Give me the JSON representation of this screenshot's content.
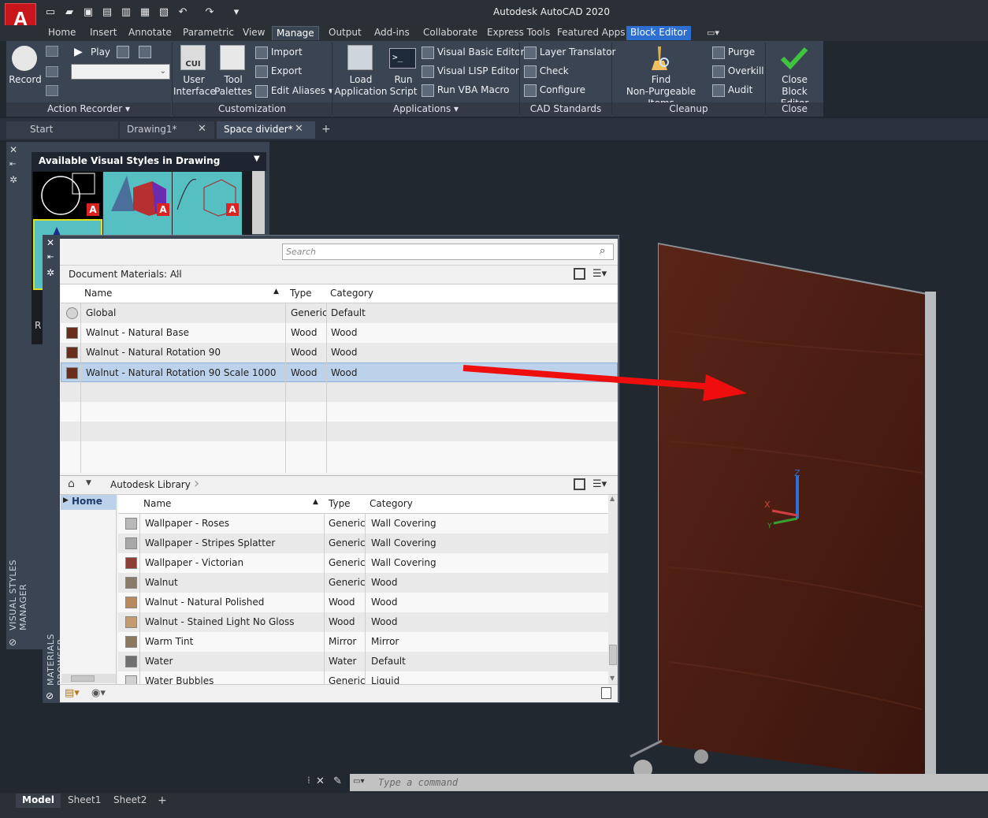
{
  "app": {
    "title": "Autodesk AutoCAD 2020",
    "logo": "A"
  },
  "quick_access": [
    "new-icon",
    "open-icon",
    "save-icon",
    "save-as-icon",
    "open-web-icon",
    "save-web-icon",
    "plot-icon",
    "undo-icon",
    "redo-icon",
    "customize-icon"
  ],
  "menu_tabs": [
    {
      "label": "Home"
    },
    {
      "label": "Insert"
    },
    {
      "label": "Annotate"
    },
    {
      "label": "Parametric"
    },
    {
      "label": "View"
    },
    {
      "label": "Manage",
      "active": true
    },
    {
      "label": "Output"
    },
    {
      "label": "Add-ins"
    },
    {
      "label": "Collaborate"
    },
    {
      "label": "Express Tools"
    },
    {
      "label": "Featured Apps"
    },
    {
      "label": "Block Editor",
      "highlight": true
    }
  ],
  "ribbon": {
    "action_recorder": {
      "record": "Record",
      "play": "Play",
      "title": "Action Recorder"
    },
    "customization": {
      "user_interface": [
        "User",
        "Interface"
      ],
      "tool_palettes": [
        "Tool",
        "Palettes"
      ],
      "import": "Import",
      "export": "Export",
      "edit_aliases": "Edit Aliases",
      "title": "Customization"
    },
    "applications": {
      "load_application": [
        "Load",
        "Application"
      ],
      "run_script": [
        "Run",
        "Script"
      ],
      "visual_basic_editor": "Visual Basic Editor",
      "visual_lisp_editor": "Visual LISP Editor",
      "run_vba_macro": "Run VBA Macro",
      "title": "Applications"
    },
    "cad_standards": {
      "layer_translator": "Layer Translator",
      "check": "Check",
      "configure": "Configure",
      "title": "CAD Standards"
    },
    "cleanup": {
      "find": [
        "Find",
        "Non-Purgeable Items"
      ],
      "purge": "Purge",
      "overkill": "Overkill",
      "audit": "Audit",
      "title": "Cleanup"
    },
    "close": {
      "close_block_editor": [
        "Close",
        "Block Editor"
      ],
      "title": "Close"
    }
  },
  "doc_tabs": [
    {
      "label": "Start"
    },
    {
      "label": "Drawing1*"
    },
    {
      "label": "Space divider*",
      "active": true
    }
  ],
  "visual_styles_manager": {
    "header": "Available Visual Styles in Drawing",
    "vertical_title": "VISUAL STYLES MANAGER",
    "footer_letter": "R"
  },
  "materials_browser": {
    "search_placeholder": "Search",
    "vertical_title": "MATERIALS BROWSER",
    "document": {
      "breadcrumb": "Document Materials: All",
      "columns": [
        "Name",
        "Type",
        "Category"
      ],
      "rows": [
        {
          "name": "Global",
          "type": "Generic",
          "category": "Default",
          "swatch": "#d4d4d4"
        },
        {
          "name": "Walnut - Natural Base",
          "type": "Wood",
          "category": "Wood",
          "swatch": "#6a2d1c"
        },
        {
          "name": "Walnut - Natural Rotation 90",
          "type": "Wood",
          "category": "Wood",
          "swatch": "#6a2d1c"
        },
        {
          "name": "Walnut - Natural Rotation 90 Scale 1000",
          "type": "Wood",
          "category": "Wood",
          "swatch": "#6a2d1c",
          "selected": true
        }
      ]
    },
    "library": {
      "breadcrumb": "Autodesk Library",
      "tree": [
        "Home"
      ],
      "columns": [
        "Name",
        "Type",
        "Category"
      ],
      "rows": [
        {
          "name": "Wallpaper - Roses",
          "type": "Generic",
          "category": "Wall Covering",
          "swatch": "#b9b9b9"
        },
        {
          "name": "Wallpaper - Stripes Splatter",
          "type": "Generic",
          "category": "Wall Covering",
          "swatch": "#a8a8a8"
        },
        {
          "name": "Wallpaper - Victorian",
          "type": "Generic",
          "category": "Wall Covering",
          "swatch": "#8e3f35"
        },
        {
          "name": "Walnut",
          "type": "Generic",
          "category": "Wood",
          "swatch": "#8a7a6a"
        },
        {
          "name": "Walnut - Natural Polished",
          "type": "Wood",
          "category": "Wood",
          "swatch": "#b88a60"
        },
        {
          "name": "Walnut - Stained Light No Gloss",
          "type": "Wood",
          "category": "Wood",
          "swatch": "#c49a70"
        },
        {
          "name": "Warm Tint",
          "type": "Mirror",
          "category": "Mirror",
          "swatch": "#8c7860"
        },
        {
          "name": "Water",
          "type": "Water",
          "category": "Default",
          "swatch": "#707070"
        },
        {
          "name": "Water Bubbles",
          "type": "Generic",
          "category": "Liquid",
          "swatch": "#d0d0d0"
        }
      ]
    }
  },
  "command_line": {
    "placeholder": "Type a command"
  },
  "layout_tabs": [
    {
      "label": "Model",
      "active": true
    },
    {
      "label": "Sheet1"
    },
    {
      "label": "Sheet2"
    }
  ],
  "ucs_axes": [
    "X",
    "Y",
    "Z"
  ]
}
